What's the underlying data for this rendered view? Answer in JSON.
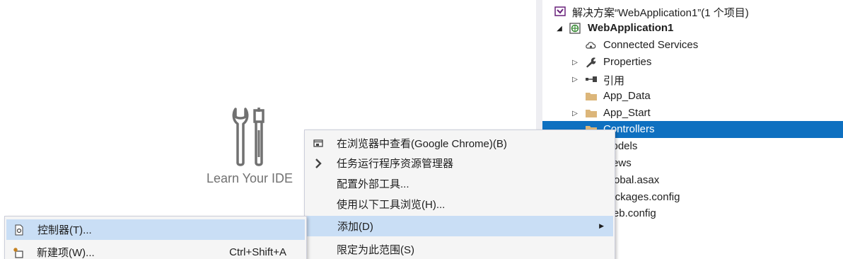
{
  "start_page": {
    "learn_label": "Learn Your IDE",
    "icon": "tools-icon"
  },
  "solution_explorer": {
    "items": [
      {
        "label": "解决方案“WebApplication1”(1 个项目)",
        "icon": "solution-icon",
        "expander": "",
        "bold": false,
        "selected": false
      },
      {
        "label": "WebApplication1",
        "icon": "web-project-icon",
        "expander": "expanded",
        "bold": true,
        "selected": false
      },
      {
        "label": "Connected Services",
        "icon": "connected-services-icon",
        "expander": "",
        "bold": false,
        "selected": false
      },
      {
        "label": "Properties",
        "icon": "wrench-icon",
        "expander": "collapsed",
        "bold": false,
        "selected": false
      },
      {
        "label": "引用",
        "icon": "references-icon",
        "expander": "collapsed",
        "bold": false,
        "selected": false
      },
      {
        "label": "App_Data",
        "icon": "folder-icon",
        "expander": "",
        "bold": false,
        "selected": false
      },
      {
        "label": "App_Start",
        "icon": "folder-icon",
        "expander": "collapsed",
        "bold": false,
        "selected": false
      },
      {
        "label": "Controllers",
        "icon": "folder-icon",
        "expander": "",
        "bold": false,
        "selected": true
      },
      {
        "label": "Models",
        "icon": "folder-icon",
        "expander": "",
        "bold": false,
        "selected": false
      },
      {
        "label": "Views",
        "icon": "folder-icon",
        "expander": "",
        "bold": false,
        "selected": false
      },
      {
        "label": "Global.asax",
        "icon": "file-icon",
        "expander": "",
        "bold": false,
        "selected": false
      },
      {
        "label": "packages.config",
        "icon": "file-icon",
        "expander": "",
        "bold": false,
        "selected": false
      },
      {
        "label": "Web.config",
        "icon": "file-icon",
        "expander": "",
        "bold": false,
        "selected": false
      }
    ]
  },
  "context_menu": {
    "items": [
      {
        "label": "在浏览器中查看(Google Chrome)(B)",
        "icon": "browser-view-icon",
        "highlighted": false,
        "submenu": false
      },
      {
        "label": "任务运行程序资源管理器",
        "icon": "chevron-right-icon",
        "highlighted": false,
        "submenu": false
      },
      {
        "label": "配置外部工具...",
        "icon": "",
        "highlighted": false,
        "submenu": false
      },
      {
        "label": "使用以下工具浏览(H)...",
        "icon": "",
        "highlighted": false,
        "submenu": false
      },
      {
        "label": "添加(D)",
        "icon": "",
        "highlighted": true,
        "submenu": true
      },
      {
        "label": "限定为此范围(S)",
        "icon": "",
        "highlighted": false,
        "submenu": false
      }
    ]
  },
  "add_submenu": {
    "items": [
      {
        "label": "控制器(T)...",
        "shortcut": "",
        "icon": "controller-icon",
        "highlighted": true
      },
      {
        "label": "新建项(W)...",
        "shortcut": "Ctrl+Shift+A",
        "icon": "new-item-icon",
        "highlighted": false
      }
    ]
  },
  "colors": {
    "selection": "#0e70c0",
    "menu_highlight": "#c9def5",
    "menu_background": "#f5f5f5",
    "folder": "#dcb67a"
  }
}
